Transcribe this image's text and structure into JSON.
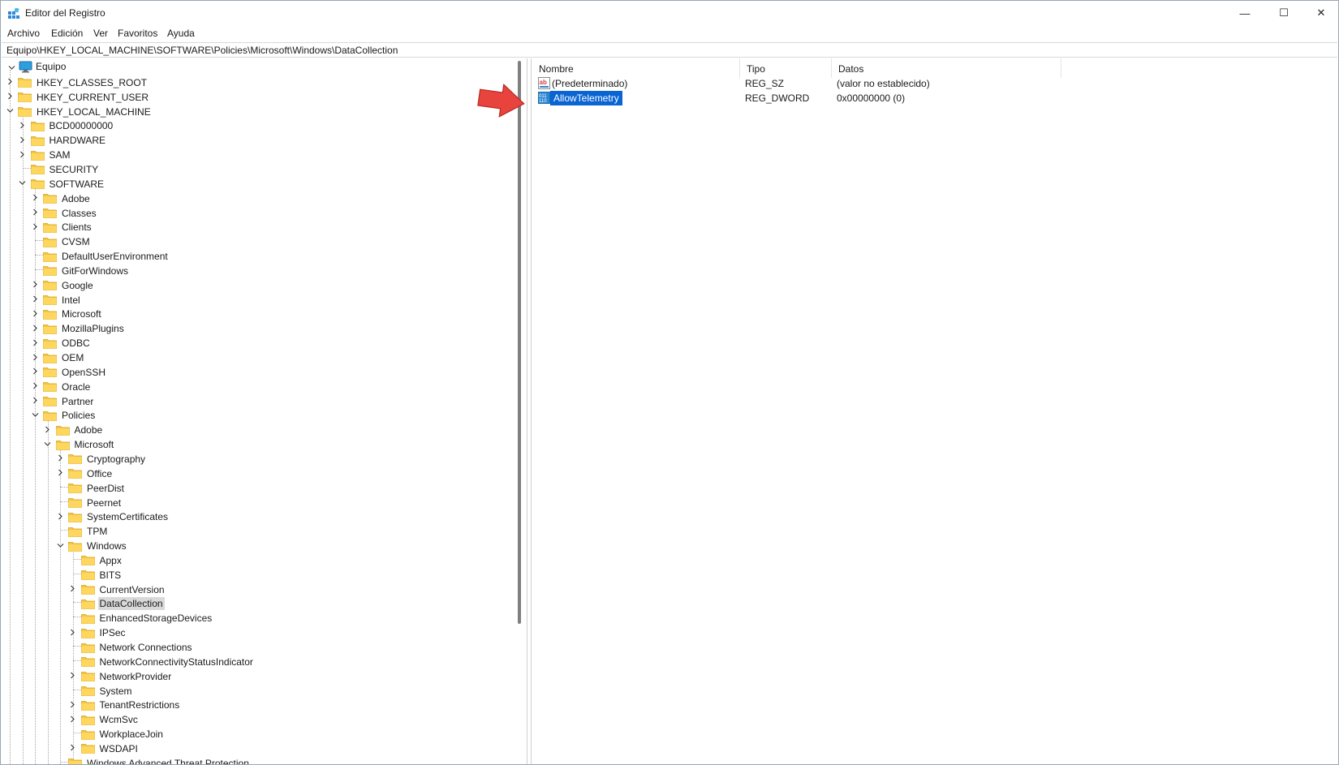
{
  "window": {
    "title": "Editor del Registro",
    "minimize_glyph": "—",
    "maximize_glyph": "☐",
    "close_glyph": "✕"
  },
  "menu": [
    "Archivo",
    "Edición",
    "Ver",
    "Favoritos",
    "Ayuda"
  ],
  "address": "Equipo\\HKEY_LOCAL_MACHINE\\SOFTWARE\\Policies\\Microsoft\\Windows\\DataCollection",
  "tree": {
    "root": "Equipo",
    "nodes": [
      {
        "label": "HKEY_CLASSES_ROOT",
        "level": 1,
        "state": "collapsed"
      },
      {
        "label": "HKEY_CURRENT_USER",
        "level": 1,
        "state": "collapsed"
      },
      {
        "label": "HKEY_LOCAL_MACHINE",
        "level": 1,
        "state": "expanded"
      },
      {
        "label": "BCD00000000",
        "level": 2,
        "state": "collapsed"
      },
      {
        "label": "HARDWARE",
        "level": 2,
        "state": "collapsed"
      },
      {
        "label": "SAM",
        "level": 2,
        "state": "collapsed"
      },
      {
        "label": "SECURITY",
        "level": 2,
        "state": "leaf"
      },
      {
        "label": "SOFTWARE",
        "level": 2,
        "state": "expanded"
      },
      {
        "label": "Adobe",
        "level": 3,
        "state": "collapsed"
      },
      {
        "label": "Classes",
        "level": 3,
        "state": "collapsed"
      },
      {
        "label": "Clients",
        "level": 3,
        "state": "collapsed"
      },
      {
        "label": "CVSM",
        "level": 3,
        "state": "leaf"
      },
      {
        "label": "DefaultUserEnvironment",
        "level": 3,
        "state": "leaf"
      },
      {
        "label": "GitForWindows",
        "level": 3,
        "state": "leaf"
      },
      {
        "label": "Google",
        "level": 3,
        "state": "collapsed"
      },
      {
        "label": "Intel",
        "level": 3,
        "state": "collapsed"
      },
      {
        "label": "Microsoft",
        "level": 3,
        "state": "collapsed"
      },
      {
        "label": "MozillaPlugins",
        "level": 3,
        "state": "collapsed"
      },
      {
        "label": "ODBC",
        "level": 3,
        "state": "collapsed"
      },
      {
        "label": "OEM",
        "level": 3,
        "state": "collapsed"
      },
      {
        "label": "OpenSSH",
        "level": 3,
        "state": "collapsed"
      },
      {
        "label": "Oracle",
        "level": 3,
        "state": "collapsed"
      },
      {
        "label": "Partner",
        "level": 3,
        "state": "collapsed"
      },
      {
        "label": "Policies",
        "level": 3,
        "state": "expanded"
      },
      {
        "label": "Adobe",
        "level": 4,
        "state": "collapsed"
      },
      {
        "label": "Microsoft",
        "level": 4,
        "state": "expanded"
      },
      {
        "label": "Cryptography",
        "level": 5,
        "state": "collapsed"
      },
      {
        "label": "Office",
        "level": 5,
        "state": "collapsed"
      },
      {
        "label": "PeerDist",
        "level": 5,
        "state": "leaf"
      },
      {
        "label": "Peernet",
        "level": 5,
        "state": "leaf"
      },
      {
        "label": "SystemCertificates",
        "level": 5,
        "state": "collapsed"
      },
      {
        "label": "TPM",
        "level": 5,
        "state": "leaf"
      },
      {
        "label": "Windows",
        "level": 5,
        "state": "expanded"
      },
      {
        "label": "Appx",
        "level": 6,
        "state": "leaf"
      },
      {
        "label": "BITS",
        "level": 6,
        "state": "leaf"
      },
      {
        "label": "CurrentVersion",
        "level": 6,
        "state": "collapsed"
      },
      {
        "label": "DataCollection",
        "level": 6,
        "state": "leaf",
        "selected": true
      },
      {
        "label": "EnhancedStorageDevices",
        "level": 6,
        "state": "leaf"
      },
      {
        "label": "IPSec",
        "level": 6,
        "state": "collapsed"
      },
      {
        "label": "Network Connections",
        "level": 6,
        "state": "leaf"
      },
      {
        "label": "NetworkConnectivityStatusIndicator",
        "level": 6,
        "state": "leaf"
      },
      {
        "label": "NetworkProvider",
        "level": 6,
        "state": "collapsed"
      },
      {
        "label": "System",
        "level": 6,
        "state": "leaf"
      },
      {
        "label": "TenantRestrictions",
        "level": 6,
        "state": "collapsed"
      },
      {
        "label": "WcmSvc",
        "level": 6,
        "state": "collapsed"
      },
      {
        "label": "WorkplaceJoin",
        "level": 6,
        "state": "leaf"
      },
      {
        "label": "WSDAPI",
        "level": 6,
        "state": "collapsed"
      },
      {
        "label": "Windows Advanced Threat Protection",
        "level": 5,
        "state": "leaf"
      }
    ]
  },
  "list": {
    "columns": [
      "Nombre",
      "Tipo",
      "Datos"
    ],
    "rows": [
      {
        "name": "(Predeterminado)",
        "type": "REG_SZ",
        "data": "(valor no establecido)",
        "icon": "string-value-icon",
        "icon_text": "ab",
        "selected": false
      },
      {
        "name": "AllowTelemetry",
        "type": "REG_DWORD",
        "data": "0x00000000 (0)",
        "icon": "dword-value-icon",
        "icon_text": "011",
        "selected": true
      }
    ]
  },
  "colors": {
    "selection": "#0a64d4",
    "folder": "#f4c542",
    "arrow": "#e8433c"
  }
}
